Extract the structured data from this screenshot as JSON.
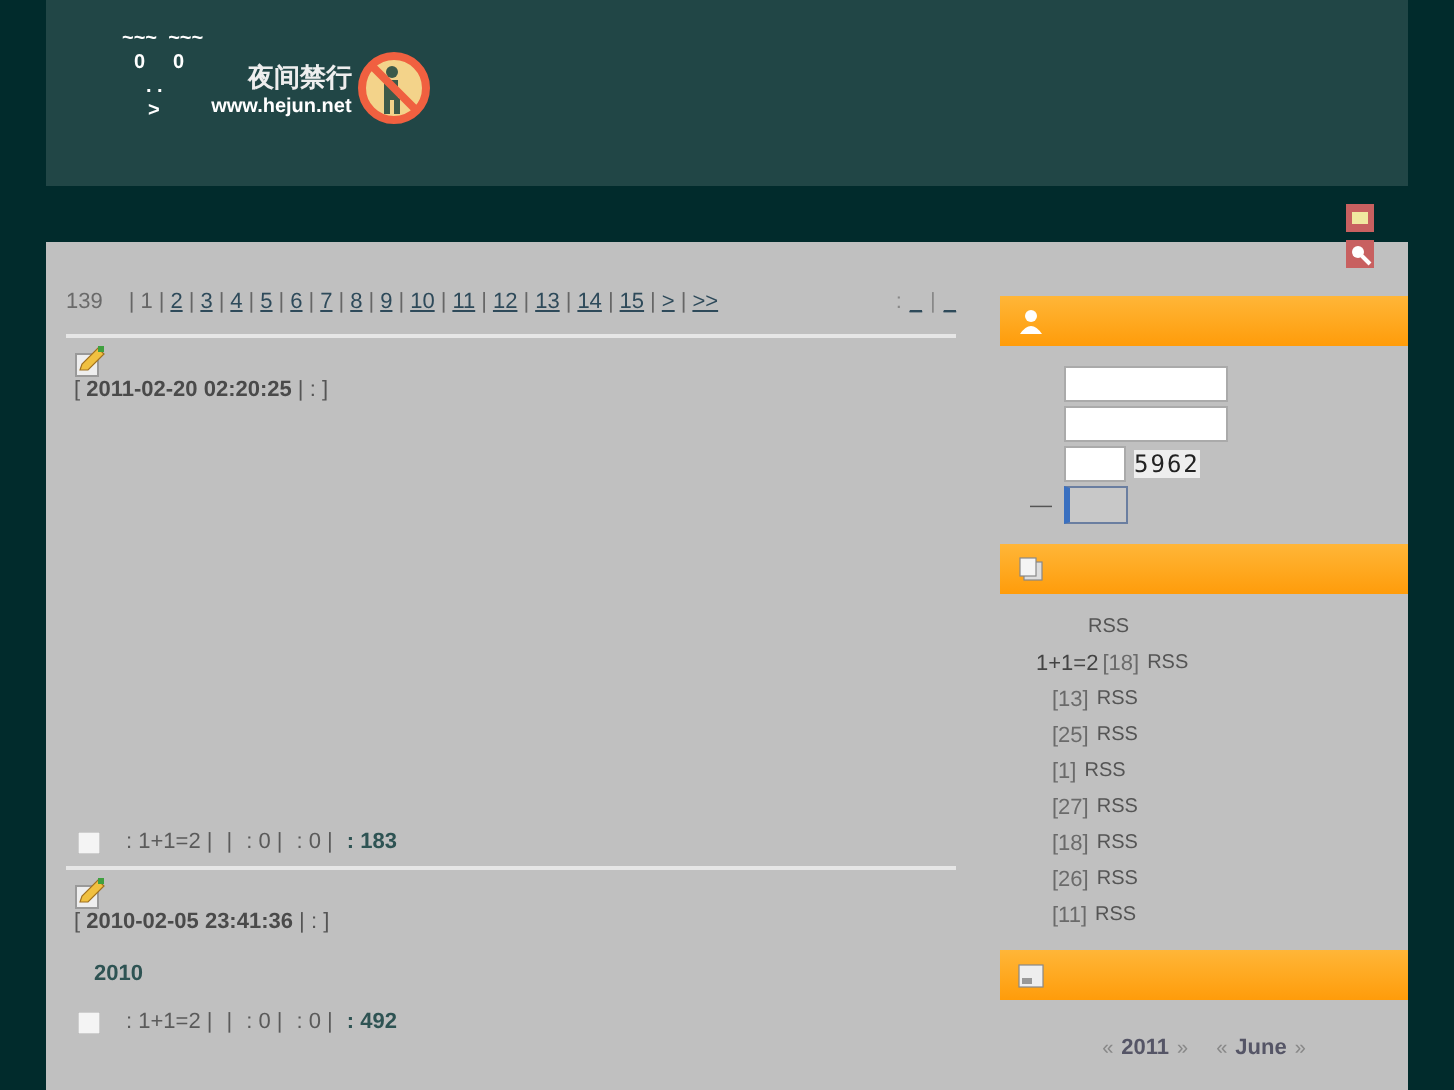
{
  "header": {
    "ascii_art": [
      "~~~  ~~~",
      "0     0",
      ". .",
      ">"
    ],
    "logo_title": "夜间禁行",
    "logo_url": "www.hejun.net"
  },
  "pager": {
    "total": "139",
    "pages": [
      {
        "separator": "|",
        "label": "1",
        "selected": true
      },
      {
        "separator": "|",
        "label": "2",
        "selected": false
      },
      {
        "separator": "|",
        "label": "3",
        "selected": false
      },
      {
        "separator": "|",
        "label": "4",
        "selected": false
      },
      {
        "separator": "|",
        "label": "5",
        "selected": false
      },
      {
        "separator": "|",
        "label": "6",
        "selected": false
      },
      {
        "separator": "|",
        "label": "7",
        "selected": false
      },
      {
        "separator": "|",
        "label": "8",
        "selected": false
      },
      {
        "separator": "|",
        "label": "9",
        "selected": false
      },
      {
        "separator": "|",
        "label": "10",
        "selected": false
      },
      {
        "separator": "|",
        "label": "11",
        "selected": false
      },
      {
        "separator": "|",
        "label": "12",
        "selected": false
      },
      {
        "separator": "|",
        "label": "13",
        "selected": false
      },
      {
        "separator": "|",
        "label": "14",
        "selected": false
      },
      {
        "separator": "|",
        "label": "15",
        "selected": false
      },
      {
        "separator": "|",
        "label": ">",
        "selected": false
      },
      {
        "separator": "|",
        "label": ">>",
        "selected": false
      }
    ],
    "right": [
      ":",
      "_",
      "|",
      "_"
    ]
  },
  "posts": [
    {
      "meta": "[ **2011-02-20 02:20:25** |  :     ]",
      "footer": [
        ": 1+1=2 |",
        "|",
        ": 0 |",
        ": 0 |"
      ],
      "views": ": 183"
    },
    {
      "meta": "[ **2010-02-05 23:41:36** |  :     ]",
      "body": "2010",
      "footer": [
        ": 1+1=2 |",
        "|",
        ": 0 |",
        ": 0 |"
      ],
      "views": ": 492"
    }
  ],
  "login": {
    "captcha": "5962",
    "dash": "—"
  },
  "categories": [
    {
      "rss": "RSS"
    },
    {
      "name": "1+1=2",
      "count": "[18]",
      "rss": "RSS"
    },
    {
      "count": "[13]",
      "rss": "RSS"
    },
    {
      "count": "[25]",
      "rss": "RSS"
    },
    {
      "count": "[1]",
      "rss": "RSS"
    },
    {
      "count": "[27]",
      "rss": "RSS"
    },
    {
      "count": "[18]",
      "rss": "RSS"
    },
    {
      "count": "[26]",
      "rss": "RSS"
    },
    {
      "count": "[11]",
      "rss": "RSS"
    }
  ],
  "calendar": {
    "year": "2011",
    "month": "June",
    "prev": "«",
    "next": "»"
  }
}
